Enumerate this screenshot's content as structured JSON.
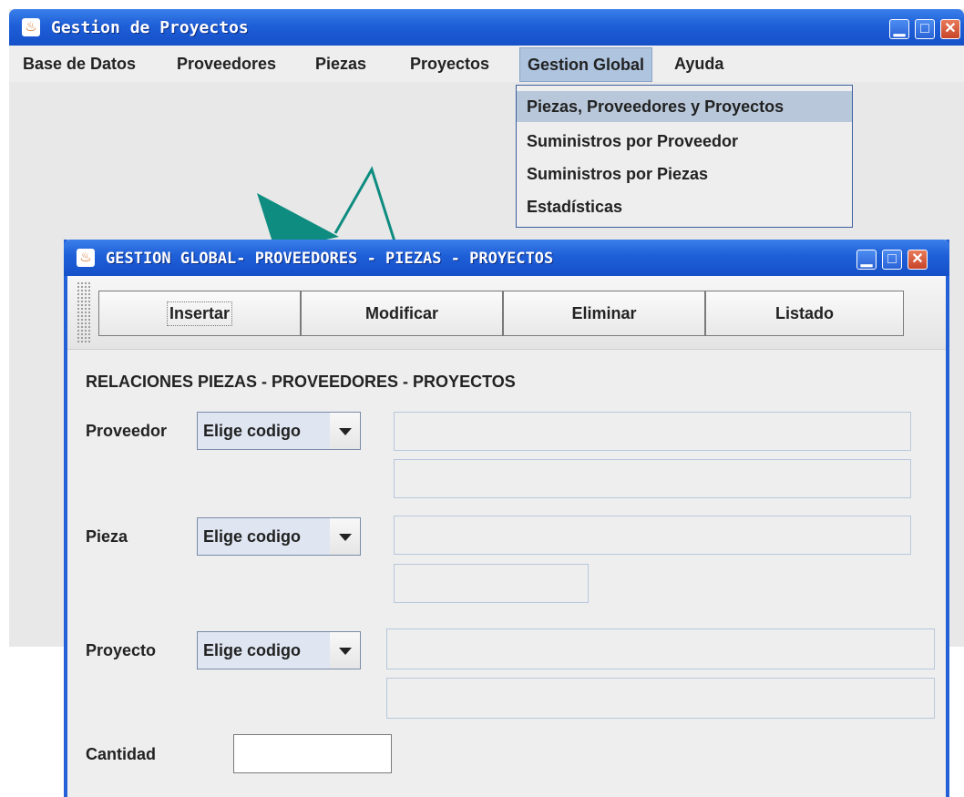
{
  "main_window": {
    "title": "Gestion de Proyectos",
    "controls": {
      "minimize": "_",
      "maximize": "□",
      "close": "✕"
    }
  },
  "menubar": {
    "items": [
      "Base de Datos",
      "Proveedores",
      "Piezas",
      "Proyectos",
      "Gestion Global",
      "Ayuda"
    ],
    "active": "Gestion Global"
  },
  "dropdown": {
    "items": [
      "Piezas, Proveedores y Proyectos",
      "Suministros por Proveedor",
      "Suministros por Piezas",
      "Estadísticas"
    ],
    "highlighted": "Piezas, Proveedores y Proyectos"
  },
  "frame": {
    "title": "GESTION GLOBAL- PROVEEDORES - PIEZAS - PROYECTOS",
    "toolbar": {
      "insert": "Insertar",
      "modify": "Modificar",
      "delete": "Eliminar",
      "list": "Listado"
    },
    "heading": "RELACIONES PIEZAS - PROVEEDORES - PROYECTOS",
    "proveedor": {
      "label": "Proveedor",
      "combo": "Elige codigo"
    },
    "pieza": {
      "label": "Pieza",
      "combo": "Elige codigo"
    },
    "proyecto": {
      "label": "Proyecto",
      "combo": "Elige codigo"
    },
    "cantidad": {
      "label": "Cantidad",
      "value": ""
    }
  },
  "colors": {
    "titlebar": "#1e5fd8",
    "logo": "#0e8c80",
    "menu_highlight": "#aec4df"
  },
  "icons": [
    "java-cup-icon",
    "minimize-icon",
    "maximize-icon",
    "close-icon",
    "chevron-down-icon"
  ]
}
